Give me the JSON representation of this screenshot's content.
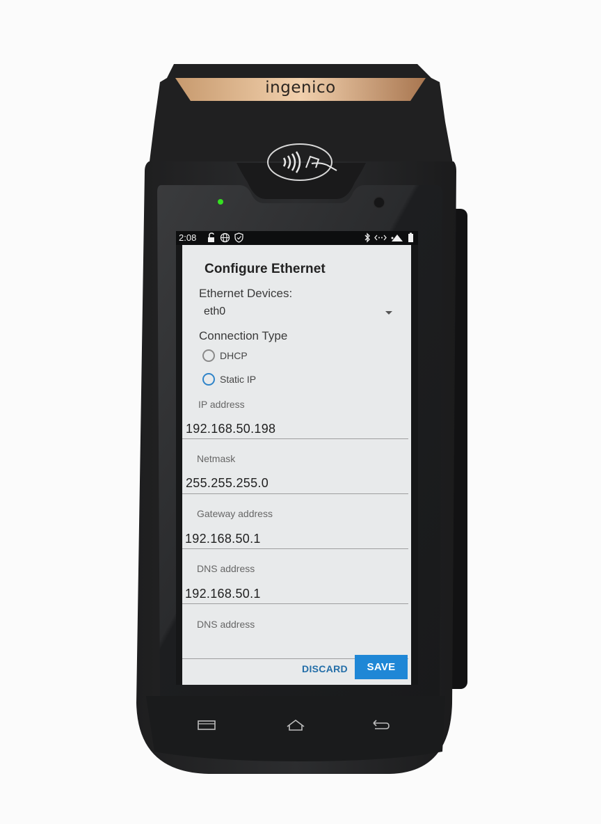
{
  "device": {
    "brand": "ingenico"
  },
  "statusbar": {
    "time": "2:08",
    "left_icons": [
      "lock-open-icon",
      "globe-icon",
      "shield-icon"
    ],
    "right_icons": [
      "bluetooth-icon",
      "ethernet-icon",
      "vpn-icon",
      "battery-icon"
    ]
  },
  "dialog": {
    "title": "Configure Ethernet",
    "devices_label": "Ethernet Devices:",
    "device_selected": "eth0",
    "connection_type_label": "Connection Type",
    "options": [
      {
        "label": "DHCP",
        "selected": false
      },
      {
        "label": "Static IP",
        "selected": false,
        "focused": true
      }
    ],
    "fields": {
      "ip": {
        "label": "IP address",
        "value": "192.168.50.198"
      },
      "netmask": {
        "label": "Netmask",
        "value": "255.255.255.0"
      },
      "gateway": {
        "label": "Gateway address",
        "value": "192.168.50.1"
      },
      "dns1": {
        "label": "DNS address",
        "value": "192.168.50.1"
      },
      "dns2": {
        "label": "DNS address",
        "value": ""
      }
    },
    "discard_label": "DISCARD",
    "save_label": "SAVE"
  },
  "navbar": [
    "recents-icon",
    "home-icon",
    "back-icon"
  ],
  "colors": {
    "accent": "#1f87d6",
    "dialog_bg": "#e8eaeb",
    "brand_strip": "#c8996a",
    "led": "#35e021"
  }
}
